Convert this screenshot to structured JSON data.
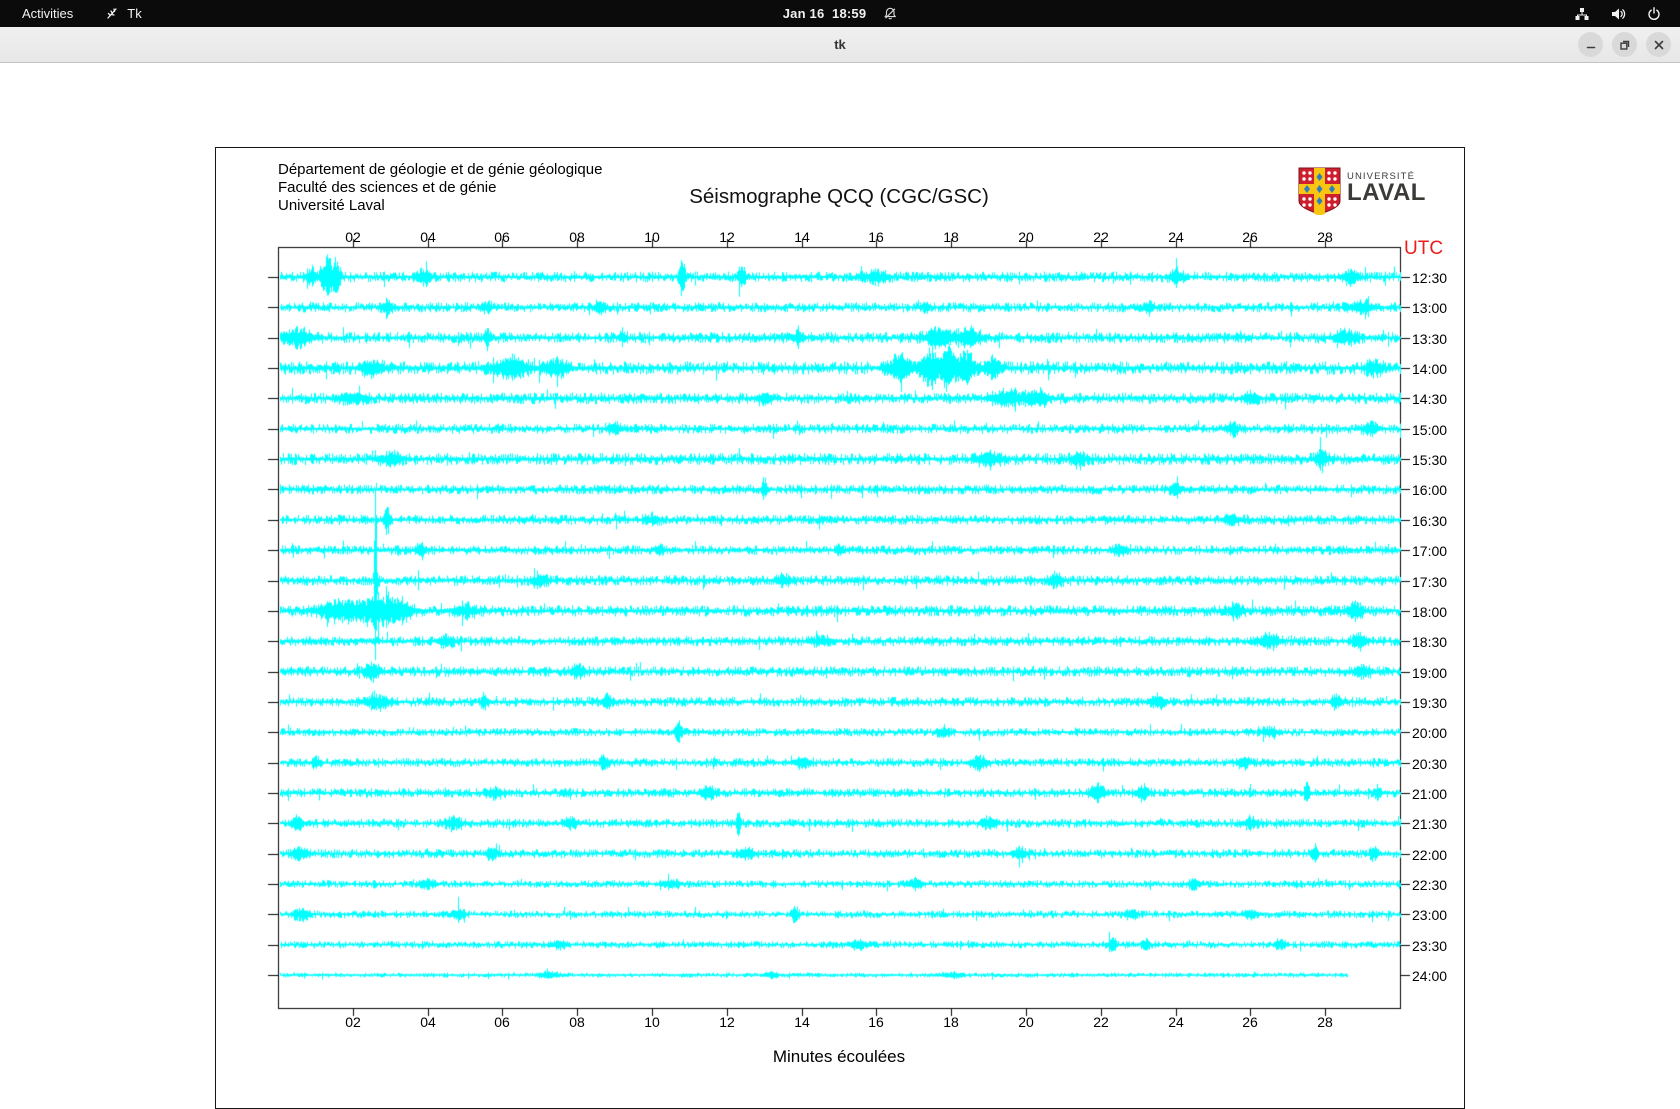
{
  "top_bar": {
    "activities_label": "Activities",
    "app_menu_label": "Tk",
    "clock": "Jan 16  18:59"
  },
  "window": {
    "title": "tk"
  },
  "document": {
    "institution_lines": [
      "Département de géologie et de génie géologique",
      "Faculté des sciences et de génie",
      "Université Laval"
    ],
    "logo": {
      "top_text": "UNIVERSITÉ",
      "bottom_text": "LAVAL",
      "shield_red": "#cf1f2e",
      "shield_yellow": "#f8c511",
      "shield_blue": "#2f7dc0",
      "text_color": "#3c3a37"
    }
  },
  "chart_data": {
    "type": "line",
    "title": "Séismographe QCQ (CGC/GSC)",
    "xlabel": "Minutes écoulées",
    "right_axis_title": "UTC",
    "right_axis_color": "#ee1c1c",
    "trace_color": "#00ffff",
    "frame_color": "#000000",
    "xlim": [
      0,
      30
    ],
    "grid": false,
    "x_tick_labels": [
      "02",
      "04",
      "06",
      "08",
      "10",
      "12",
      "14",
      "16",
      "18",
      "20",
      "22",
      "24",
      "26",
      "28"
    ],
    "x_tick_minutes": [
      2,
      4,
      6,
      8,
      10,
      12,
      14,
      16,
      18,
      20,
      22,
      24,
      26,
      28
    ],
    "rows": [
      {
        "utc": "12:30",
        "base_amp": 3.2,
        "events": [
          {
            "m": 0.9,
            "a": 8,
            "w": 0.15
          },
          {
            "m": 1.3,
            "a": 26,
            "w": 0.12
          },
          {
            "m": 1.55,
            "a": 18,
            "w": 0.1
          },
          {
            "m": 3.9,
            "a": 6,
            "w": 0.2
          },
          {
            "m": 10.8,
            "a": 20,
            "w": 0.07
          },
          {
            "m": 12.4,
            "a": 9,
            "w": 0.1
          },
          {
            "m": 16.0,
            "a": 5,
            "w": 0.3
          },
          {
            "m": 24.0,
            "a": 6,
            "w": 0.15
          },
          {
            "m": 28.7,
            "a": 7,
            "w": 0.2
          }
        ]
      },
      {
        "utc": "13:00",
        "base_amp": 3.0,
        "events": [
          {
            "m": 2.9,
            "a": 8,
            "w": 0.12
          },
          {
            "m": 5.6,
            "a": 6,
            "w": 0.1
          },
          {
            "m": 8.6,
            "a": 5,
            "w": 0.15
          },
          {
            "m": 17.3,
            "a": 6,
            "w": 0.1
          },
          {
            "m": 23.3,
            "a": 5,
            "w": 0.1
          },
          {
            "m": 29.0,
            "a": 6,
            "w": 0.3
          }
        ]
      },
      {
        "utc": "13:30",
        "base_amp": 3.4,
        "events": [
          {
            "m": 0.5,
            "a": 8,
            "w": 0.4
          },
          {
            "m": 5.6,
            "a": 7,
            "w": 0.1
          },
          {
            "m": 9.2,
            "a": 6,
            "w": 0.1
          },
          {
            "m": 13.9,
            "a": 7,
            "w": 0.15
          },
          {
            "m": 17.7,
            "a": 9,
            "w": 0.4
          },
          {
            "m": 18.5,
            "a": 8,
            "w": 0.3
          },
          {
            "m": 28.5,
            "a": 6,
            "w": 0.3
          }
        ]
      },
      {
        "utc": "14:00",
        "base_amp": 4.0,
        "events": [
          {
            "m": 2.5,
            "a": 6,
            "w": 0.3
          },
          {
            "m": 6.2,
            "a": 9,
            "w": 0.5
          },
          {
            "m": 7.4,
            "a": 7,
            "w": 0.3
          },
          {
            "m": 16.6,
            "a": 12,
            "w": 0.3
          },
          {
            "m": 17.4,
            "a": 20,
            "w": 0.2
          },
          {
            "m": 17.9,
            "a": 24,
            "w": 0.18
          },
          {
            "m": 18.4,
            "a": 16,
            "w": 0.25
          },
          {
            "m": 19.1,
            "a": 8,
            "w": 0.2
          },
          {
            "m": 29.3,
            "a": 7,
            "w": 0.2
          }
        ]
      },
      {
        "utc": "14:30",
        "base_amp": 3.4,
        "events": [
          {
            "m": 2.0,
            "a": 5,
            "w": 0.3
          },
          {
            "m": 13.0,
            "a": 5,
            "w": 0.2
          },
          {
            "m": 19.5,
            "a": 8,
            "w": 0.4
          },
          {
            "m": 20.3,
            "a": 7,
            "w": 0.3
          },
          {
            "m": 26.0,
            "a": 5,
            "w": 0.2
          }
        ]
      },
      {
        "utc": "15:00",
        "base_amp": 3.0,
        "events": [
          {
            "m": 9.0,
            "a": 4,
            "w": 0.2
          },
          {
            "m": 25.5,
            "a": 6,
            "w": 0.15
          },
          {
            "m": 29.2,
            "a": 6,
            "w": 0.2
          }
        ]
      },
      {
        "utc": "15:30",
        "base_amp": 3.6,
        "events": [
          {
            "m": 3.0,
            "a": 5,
            "w": 0.3
          },
          {
            "m": 19.0,
            "a": 6,
            "w": 0.3
          },
          {
            "m": 21.4,
            "a": 6,
            "w": 0.2
          },
          {
            "m": 27.9,
            "a": 6,
            "w": 0.2
          }
        ]
      },
      {
        "utc": "16:00",
        "base_amp": 3.0,
        "events": [
          {
            "m": 13.0,
            "a": 11,
            "w": 0.07
          },
          {
            "m": 24.0,
            "a": 5,
            "w": 0.15
          }
        ]
      },
      {
        "utc": "16:30",
        "base_amp": 3.0,
        "events": [
          {
            "m": 2.9,
            "a": 17,
            "w": 0.08
          },
          {
            "m": 10.0,
            "a": 4,
            "w": 0.2
          },
          {
            "m": 25.5,
            "a": 5,
            "w": 0.2
          }
        ]
      },
      {
        "utc": "17:00",
        "base_amp": 2.9,
        "events": [
          {
            "m": 3.8,
            "a": 7,
            "w": 0.12
          },
          {
            "m": 10.2,
            "a": 5,
            "w": 0.1
          },
          {
            "m": 15.0,
            "a": 6,
            "w": 0.08
          },
          {
            "m": 22.5,
            "a": 4,
            "w": 0.2
          }
        ]
      },
      {
        "utc": "17:30",
        "base_amp": 3.1,
        "events": [
          {
            "m": 2.6,
            "a": 102,
            "w": 0.035
          },
          {
            "m": 7.0,
            "a": 6,
            "w": 0.2
          },
          {
            "m": 13.5,
            "a": 5,
            "w": 0.2
          },
          {
            "m": 20.8,
            "a": 6,
            "w": 0.15
          }
        ]
      },
      {
        "utc": "18:00",
        "base_amp": 3.4,
        "events": [
          {
            "m": 1.7,
            "a": 10,
            "w": 0.6
          },
          {
            "m": 2.6,
            "a": 13,
            "w": 0.4
          },
          {
            "m": 3.2,
            "a": 11,
            "w": 0.35
          },
          {
            "m": 5.0,
            "a": 6,
            "w": 0.3
          },
          {
            "m": 25.6,
            "a": 7,
            "w": 0.2
          },
          {
            "m": 28.8,
            "a": 7,
            "w": 0.2
          }
        ]
      },
      {
        "utc": "18:30",
        "base_amp": 3.0,
        "events": [
          {
            "m": 4.5,
            "a": 5,
            "w": 0.2
          },
          {
            "m": 14.5,
            "a": 4,
            "w": 0.3
          },
          {
            "m": 26.5,
            "a": 7,
            "w": 0.25
          },
          {
            "m": 28.9,
            "a": 7,
            "w": 0.2
          }
        ]
      },
      {
        "utc": "19:00",
        "base_amp": 3.1,
        "events": [
          {
            "m": 2.5,
            "a": 7,
            "w": 0.2
          },
          {
            "m": 8.0,
            "a": 5,
            "w": 0.2
          },
          {
            "m": 29.0,
            "a": 6,
            "w": 0.2
          }
        ]
      },
      {
        "utc": "19:30",
        "base_amp": 2.9,
        "events": [
          {
            "m": 2.6,
            "a": 7,
            "w": 0.3
          },
          {
            "m": 5.5,
            "a": 9,
            "w": 0.08
          },
          {
            "m": 8.8,
            "a": 5,
            "w": 0.15
          },
          {
            "m": 23.5,
            "a": 5,
            "w": 0.2
          },
          {
            "m": 28.3,
            "a": 6,
            "w": 0.15
          }
        ]
      },
      {
        "utc": "20:00",
        "base_amp": 2.5,
        "events": [
          {
            "m": 10.7,
            "a": 9,
            "w": 0.1
          },
          {
            "m": 17.8,
            "a": 5,
            "w": 0.15
          },
          {
            "m": 26.5,
            "a": 4,
            "w": 0.2
          }
        ]
      },
      {
        "utc": "20:30",
        "base_amp": 2.7,
        "events": [
          {
            "m": 1.0,
            "a": 7,
            "w": 0.08
          },
          {
            "m": 8.7,
            "a": 6,
            "w": 0.12
          },
          {
            "m": 14.0,
            "a": 5,
            "w": 0.2
          },
          {
            "m": 18.7,
            "a": 6,
            "w": 0.2
          },
          {
            "m": 25.8,
            "a": 5,
            "w": 0.15
          }
        ]
      },
      {
        "utc": "21:00",
        "base_amp": 2.8,
        "events": [
          {
            "m": 5.8,
            "a": 5,
            "w": 0.2
          },
          {
            "m": 11.5,
            "a": 5,
            "w": 0.2
          },
          {
            "m": 21.9,
            "a": 8,
            "w": 0.2
          },
          {
            "m": 23.1,
            "a": 7,
            "w": 0.15
          },
          {
            "m": 27.5,
            "a": 14,
            "w": 0.06
          },
          {
            "m": 29.4,
            "a": 8,
            "w": 0.1
          }
        ]
      },
      {
        "utc": "21:30",
        "base_amp": 2.7,
        "events": [
          {
            "m": 0.5,
            "a": 6,
            "w": 0.15
          },
          {
            "m": 4.7,
            "a": 6,
            "w": 0.2
          },
          {
            "m": 7.8,
            "a": 6,
            "w": 0.15
          },
          {
            "m": 12.3,
            "a": 12,
            "w": 0.06
          },
          {
            "m": 19.0,
            "a": 5,
            "w": 0.2
          },
          {
            "m": 26.0,
            "a": 5,
            "w": 0.2
          }
        ]
      },
      {
        "utc": "22:00",
        "base_amp": 2.7,
        "events": [
          {
            "m": 0.6,
            "a": 6,
            "w": 0.2
          },
          {
            "m": 5.7,
            "a": 7,
            "w": 0.12
          },
          {
            "m": 12.5,
            "a": 5,
            "w": 0.2
          },
          {
            "m": 19.8,
            "a": 5,
            "w": 0.2
          },
          {
            "m": 27.7,
            "a": 11,
            "w": 0.08
          },
          {
            "m": 29.3,
            "a": 7,
            "w": 0.1
          }
        ]
      },
      {
        "utc": "22:30",
        "base_amp": 2.3,
        "events": [
          {
            "m": 4.0,
            "a": 5,
            "w": 0.2
          },
          {
            "m": 10.5,
            "a": 4,
            "w": 0.2
          },
          {
            "m": 17.0,
            "a": 4,
            "w": 0.2
          },
          {
            "m": 24.5,
            "a": 5,
            "w": 0.15
          }
        ]
      },
      {
        "utc": "23:00",
        "base_amp": 2.3,
        "events": [
          {
            "m": 0.6,
            "a": 6,
            "w": 0.2
          },
          {
            "m": 4.8,
            "a": 6,
            "w": 0.15
          },
          {
            "m": 13.8,
            "a": 8,
            "w": 0.1
          },
          {
            "m": 22.8,
            "a": 5,
            "w": 0.15
          },
          {
            "m": 26.0,
            "a": 4,
            "w": 0.2
          }
        ]
      },
      {
        "utc": "23:30",
        "base_amp": 2.2,
        "events": [
          {
            "m": 7.5,
            "a": 4,
            "w": 0.2
          },
          {
            "m": 15.5,
            "a": 4,
            "w": 0.2
          },
          {
            "m": 22.3,
            "a": 7,
            "w": 0.12
          },
          {
            "m": 23.2,
            "a": 6,
            "w": 0.1
          },
          {
            "m": 26.8,
            "a": 5,
            "w": 0.15
          }
        ]
      },
      {
        "utc": "24:00",
        "base_amp": 1.5,
        "end_minute": 28.6,
        "events": [
          {
            "m": 7.2,
            "a": 3,
            "w": 0.3
          },
          {
            "m": 13.2,
            "a": 3,
            "w": 0.2
          },
          {
            "m": 18.0,
            "a": 2.5,
            "w": 0.3
          }
        ]
      }
    ]
  }
}
